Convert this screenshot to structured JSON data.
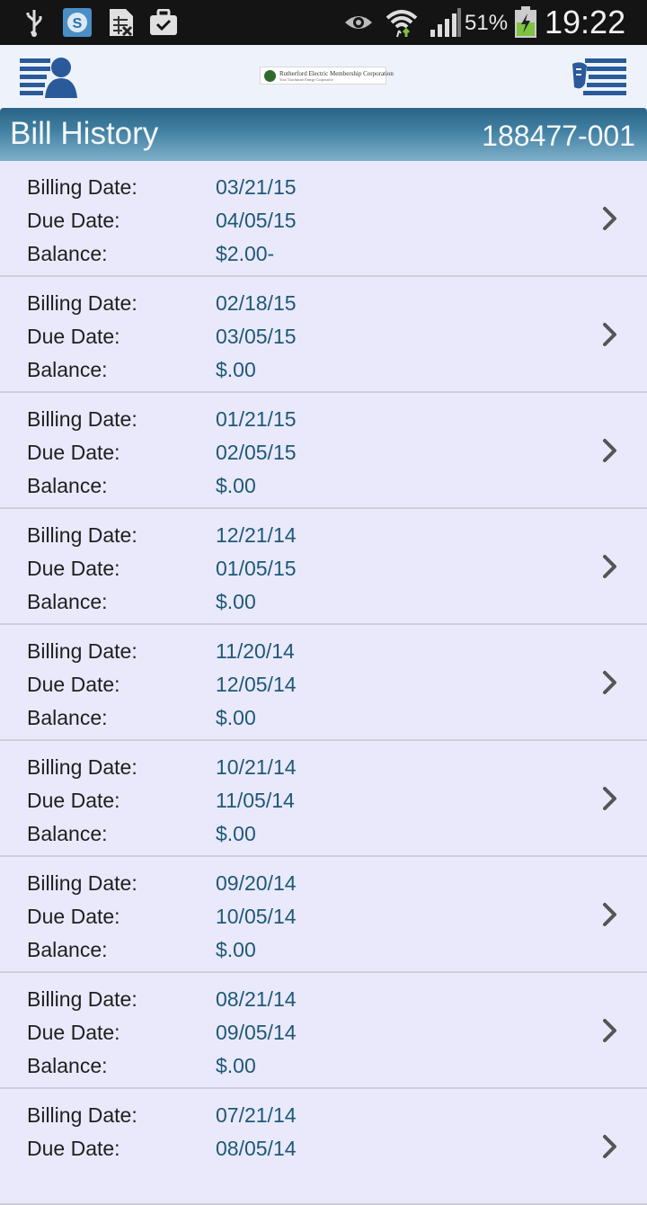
{
  "status_bar": {
    "icons": [
      "usb-icon",
      "skype-icon",
      "spreadsheet-icon",
      "briefcase-check-icon",
      "eye-icon",
      "wifi-icon",
      "signal-icon",
      "battery-charging-icon"
    ],
    "battery": "51%",
    "time": "19:22"
  },
  "header": {
    "left_icon": "account-menu-icon",
    "right_icon": "pay-bill-menu-icon",
    "logo_text": "Rutherford Electric Membership Corporation",
    "logo_sub": "Your Touchstone Energy Cooperative"
  },
  "title_bar": {
    "title": "Bill History",
    "account": "188477-001"
  },
  "labels": {
    "billing": "Billing Date:",
    "due": "Due Date:",
    "balance": "Balance:"
  },
  "bills": [
    {
      "billing_date": "03/21/15",
      "due_date": "04/05/15",
      "balance": "$2.00-"
    },
    {
      "billing_date": "02/18/15",
      "due_date": "03/05/15",
      "balance": "$.00"
    },
    {
      "billing_date": "01/21/15",
      "due_date": "02/05/15",
      "balance": "$.00"
    },
    {
      "billing_date": "12/21/14",
      "due_date": "01/05/15",
      "balance": "$.00"
    },
    {
      "billing_date": "11/20/14",
      "due_date": "12/05/14",
      "balance": "$.00"
    },
    {
      "billing_date": "10/21/14",
      "due_date": "11/05/14",
      "balance": "$.00"
    },
    {
      "billing_date": "09/20/14",
      "due_date": "10/05/14",
      "balance": "$.00"
    },
    {
      "billing_date": "08/21/14",
      "due_date": "09/05/14",
      "balance": "$.00"
    },
    {
      "billing_date": "07/21/14",
      "due_date": "08/05/14",
      "balance": ""
    }
  ],
  "colors": {
    "title_bar": "#3f7ea0",
    "value_text": "#1f5877",
    "list_bg": "#e9e9fb",
    "header_icon": "#2a5a9a"
  }
}
